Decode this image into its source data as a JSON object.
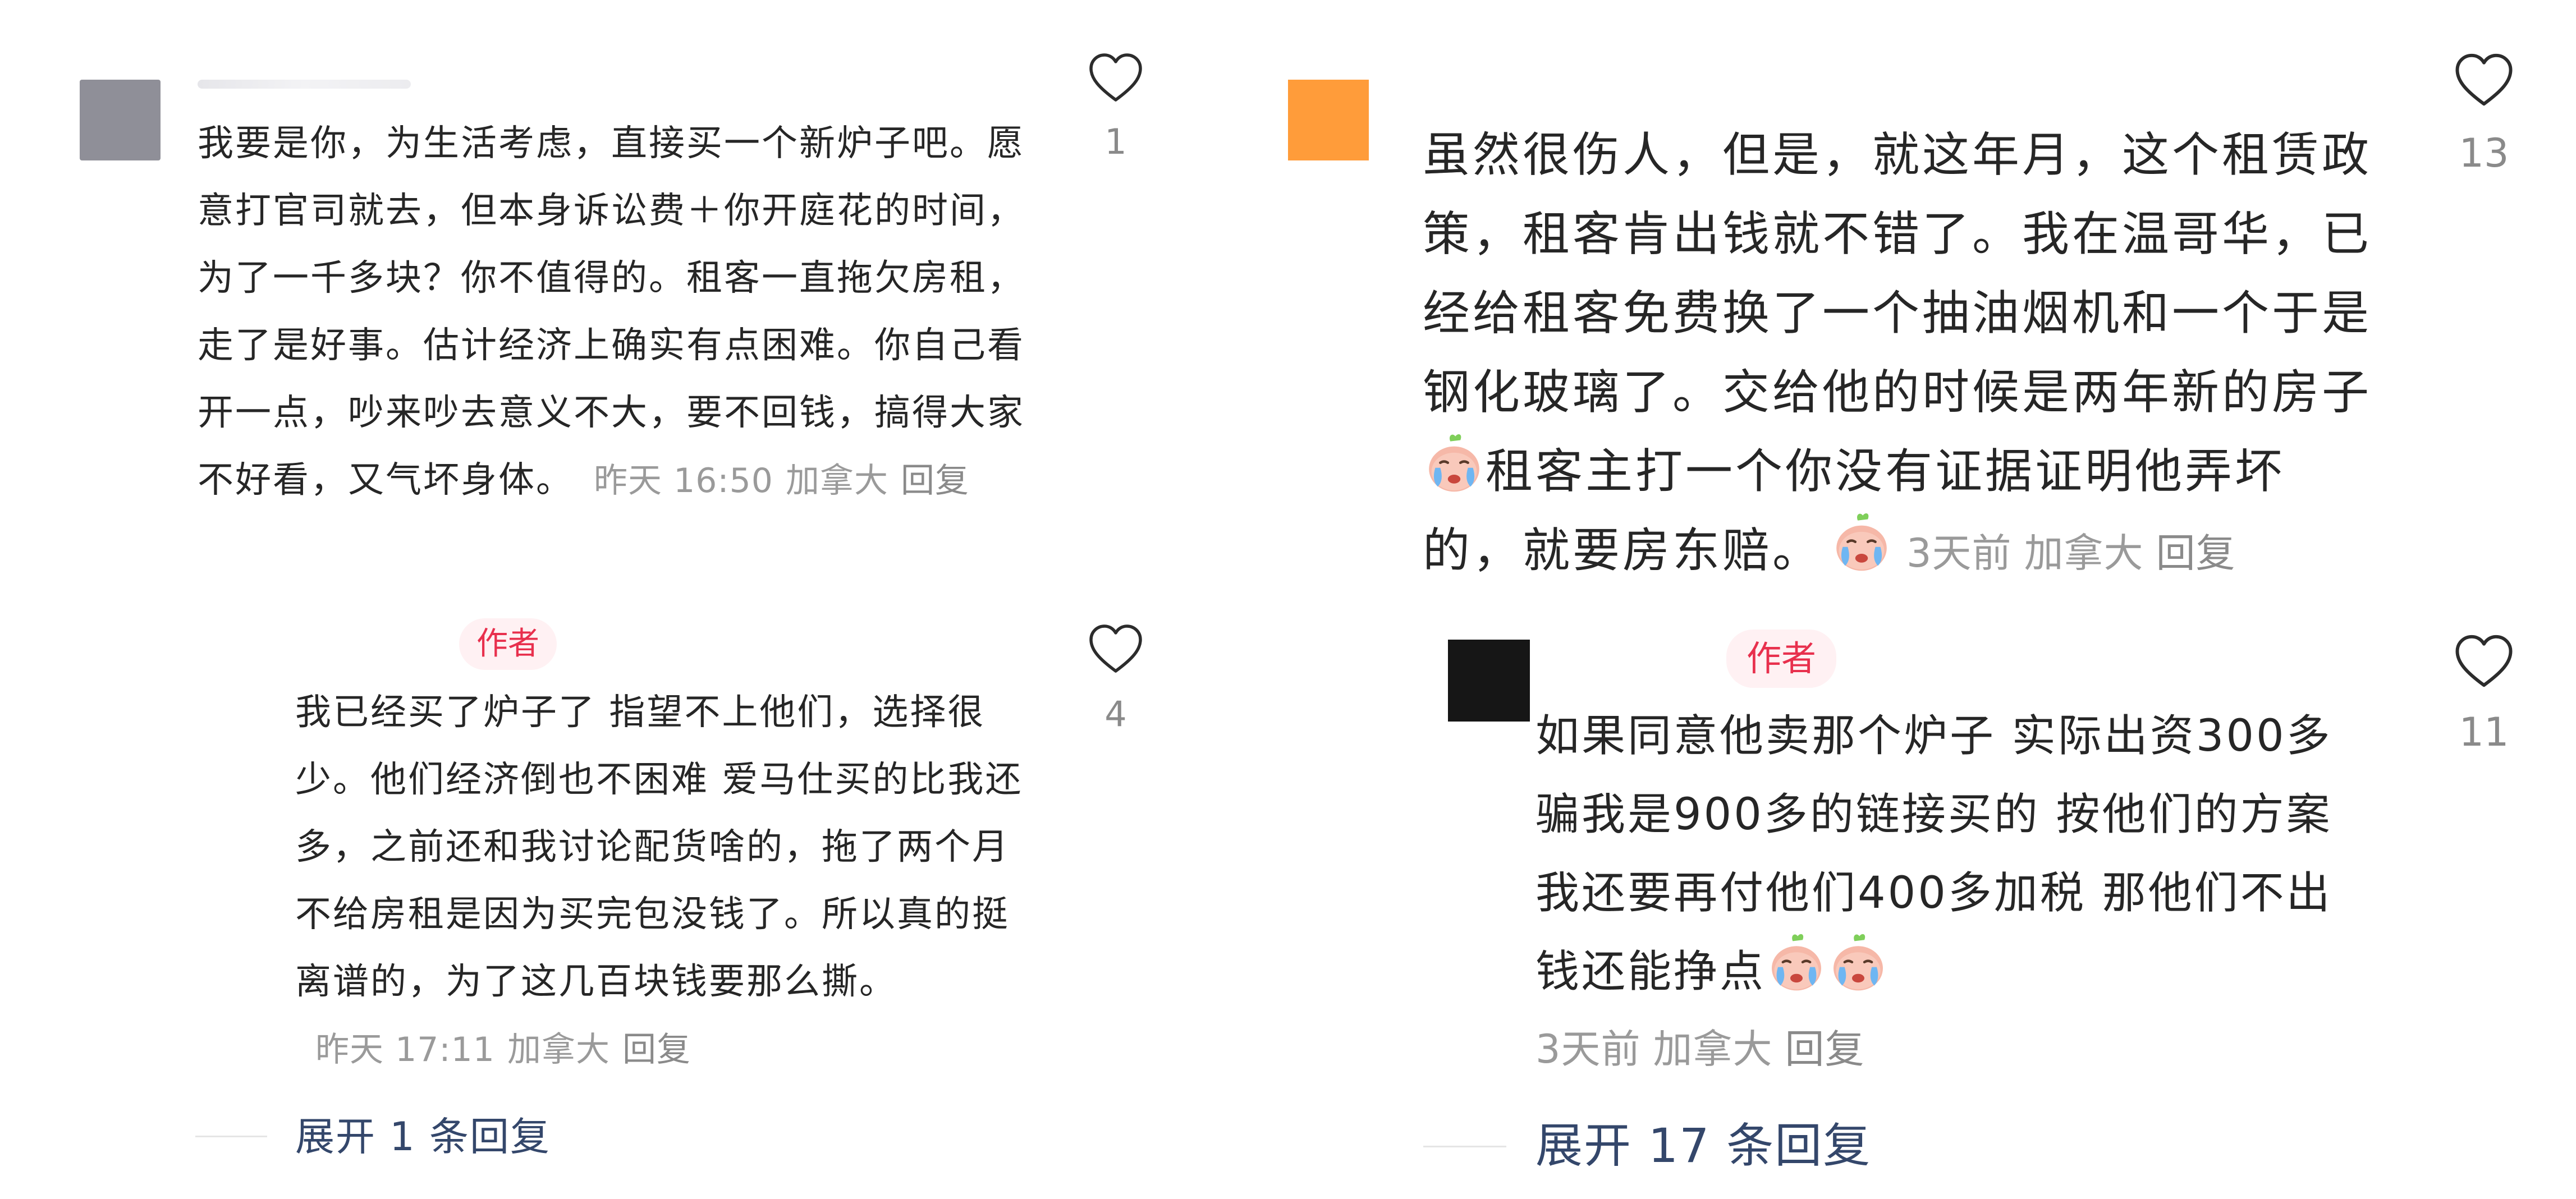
{
  "colors": {
    "author_badge_bg": "#fff1f3",
    "author_badge_text": "#e8304d",
    "expand_text": "#34476b",
    "meta_text": "#9a9a9a",
    "avatar_gray": "#8f8f98",
    "avatar_orange": "#ff9c3a",
    "avatar_black": "#161616"
  },
  "left": {
    "comment1": {
      "text": "我要是你，为生活考虑，直接买一个新炉子吧。愿意打官司就去，但本身诉讼费＋你开庭花的时间，为了一千多块？你不值得的。租客一直拖欠房租，走了是好事。估计经济上确实有点困难。你自己看开一点，吵来吵去意义不大，要不回钱，搞得大家不好看，又气坏身体。",
      "time": "昨天 16:50",
      "location": "加拿大",
      "reply": "回复",
      "likes": "1",
      "avatar_icon": "user-avatar-blurred"
    },
    "reply1": {
      "badge": "作者",
      "text": "我已经买了炉子了 指望不上他们，选择很少。他们经济倒也不困难 爱马仕买的比我还多，之前还和我讨论配货啥的，拖了两个月不给房租是因为买完包没钱了。所以真的挺离谱的，为了这几百块钱要那么撕。",
      "time": "昨天 17:11",
      "location": "加拿大",
      "reply": "回复",
      "likes": "4"
    },
    "expand": "展开 1 条回复"
  },
  "right": {
    "comment1": {
      "text_a": "虽然很伤人，但是，就这年月，这个租赁政策，租客肯出钱就不错了。我在温哥华，已经给租客免费换了一个抽油烟机和一个于是钢化玻璃了。交给他的时候是两年新的房子",
      "text_b": "租客主打一个你没有证据证明他弄坏的，就要房东赔。",
      "emoji_icon": "crying-emoji-icon",
      "time": "3天前",
      "location": "加拿大",
      "reply": "回复",
      "likes": "13",
      "avatar_icon": "orange-avatar"
    },
    "reply1": {
      "badge": "作者",
      "text": "如果同意他卖那个炉子 实际出资300多骗我是900多的链接买的 按他们的方案 我还要再付他们400多加税 那他们不出钱还能挣点",
      "time": "3天前",
      "location": "加拿大",
      "reply": "回复",
      "likes": "11",
      "avatar_icon": "black-avatar"
    },
    "expand": "展开 17 条回复"
  }
}
